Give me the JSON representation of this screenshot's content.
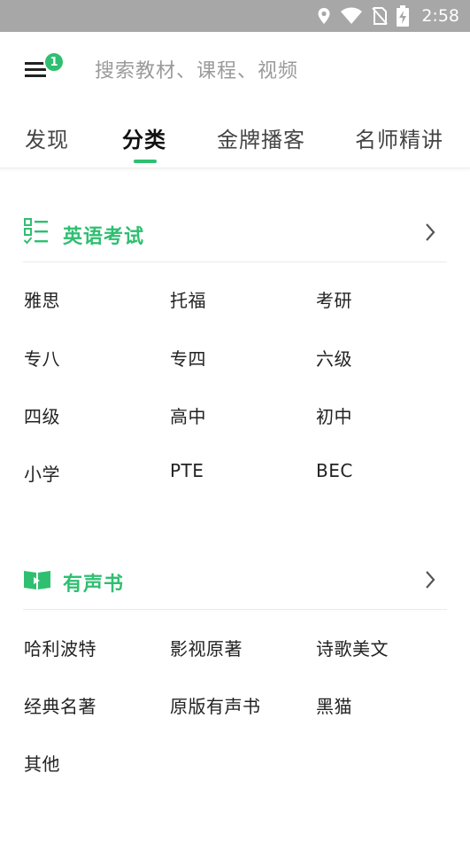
{
  "status_bar": {
    "time": "2:58",
    "icons": [
      "location-icon",
      "wifi-icon",
      "no-sim-icon",
      "battery-charging-icon"
    ]
  },
  "header": {
    "menu_icon": "hamburger-menu-icon",
    "menu_badge": "1",
    "search_placeholder": "搜索教材、课程、视频"
  },
  "tabs": [
    {
      "label": "发现",
      "active": false
    },
    {
      "label": "分类",
      "active": true
    },
    {
      "label": "金牌播客",
      "active": false
    },
    {
      "label": "名师精讲",
      "active": false
    }
  ],
  "accent_color": "#2fbf71",
  "sections": [
    {
      "title": "英语考试",
      "icon": "checklist-icon",
      "items": [
        "雅思",
        "托福",
        "考研",
        "专八",
        "专四",
        "六级",
        "四级",
        "高中",
        "初中",
        "小学",
        "PTE",
        "BEC"
      ]
    },
    {
      "title": "有声书",
      "icon": "open-book-icon",
      "items": [
        "哈利波特",
        "影视原著",
        "诗歌美文",
        "经典名著",
        "原版有声书",
        "黑猫",
        "其他"
      ]
    }
  ]
}
